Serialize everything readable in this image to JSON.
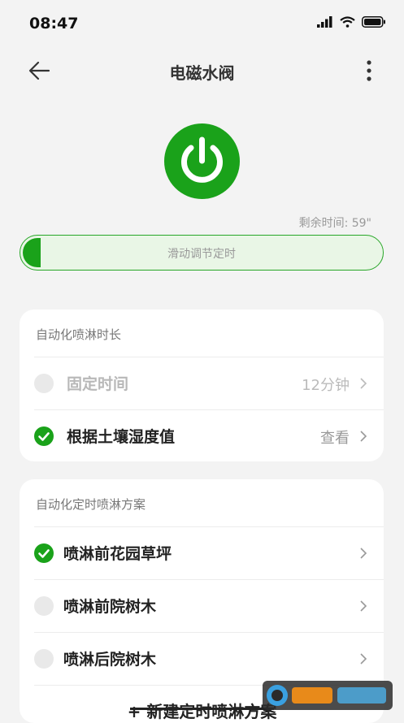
{
  "status_bar": {
    "time": "08:47"
  },
  "header": {
    "title": "电磁水阀"
  },
  "timer": {
    "remaining": "剩余时间: 59\""
  },
  "slider": {
    "label": "滑动调节定时",
    "fill_fraction": 0.05
  },
  "card_duration": {
    "title": "自动化喷淋时长",
    "rows": [
      {
        "label": "固定时间",
        "value": "12分钟",
        "checked": false,
        "disabled": true
      },
      {
        "label": "根据土壤湿度值",
        "value": "查看",
        "checked": true,
        "disabled": false
      }
    ]
  },
  "card_schedule": {
    "title": "自动化定时喷淋方案",
    "rows": [
      {
        "label": "喷淋前花园草坪",
        "checked": true
      },
      {
        "label": "喷淋前院树木",
        "checked": false
      },
      {
        "label": "喷淋后院树木",
        "checked": false
      }
    ],
    "add_label": "+ 新建定时喷淋方案"
  },
  "colors": {
    "accent": "#1aa21a",
    "background": "#f3f3f3"
  },
  "icons": [
    "back-arrow-icon",
    "more-vertical-icon",
    "power-icon",
    "check-icon",
    "chevron-right-icon",
    "signal-icon",
    "wifi-icon",
    "battery-icon"
  ]
}
